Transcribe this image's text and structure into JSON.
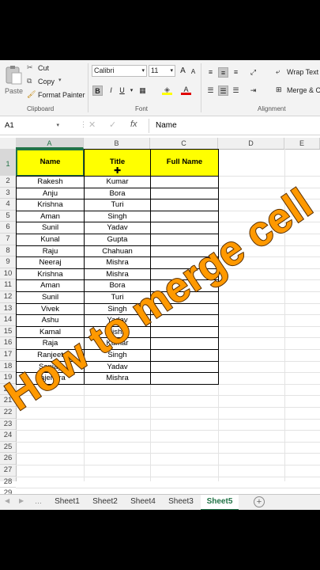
{
  "ribbon": {
    "clipboard": {
      "paste_label": "Paste",
      "cut_label": "Cut",
      "copy_label": "Copy",
      "format_painter_label": "Format Painter",
      "group_label": "Clipboard"
    },
    "font": {
      "font_name": "Calibri",
      "font_size": "11",
      "bold": "B",
      "italic": "I",
      "underline": "U",
      "grow": "A",
      "shrink": "A",
      "group_label": "Font"
    },
    "alignment": {
      "wrap_text_label": "Wrap Text",
      "merge_label": "Merge & C",
      "group_label": "Alignment"
    }
  },
  "formula_bar": {
    "name_box": "A1",
    "fx": "fx",
    "content": "Name"
  },
  "columns": [
    "A",
    "B",
    "C",
    "D",
    "E"
  ],
  "rows": [
    "1",
    "2",
    "3",
    "4",
    "5",
    "6",
    "7",
    "8",
    "9",
    "10",
    "11",
    "12",
    "13",
    "14",
    "15",
    "16",
    "17",
    "18",
    "19",
    "20",
    "21",
    "22",
    "23",
    "24",
    "25",
    "26",
    "27",
    "28",
    "29"
  ],
  "table": {
    "headers": [
      "Name",
      "Title",
      "Full Name"
    ],
    "rows": [
      [
        "Rakesh",
        "Kumar"
      ],
      [
        "Anju",
        "Bora"
      ],
      [
        "Krishna",
        "Turi"
      ],
      [
        "Aman",
        "Singh"
      ],
      [
        "Sunil",
        "Yadav"
      ],
      [
        "Kunal",
        "Gupta"
      ],
      [
        "Raju",
        "Chahuan"
      ],
      [
        "Neeraj",
        "Mishra"
      ],
      [
        "Krishna",
        "Mishra"
      ],
      [
        "Aman",
        "Bora"
      ],
      [
        "Sunil",
        "Turi"
      ],
      [
        "Vivek",
        "Singh"
      ],
      [
        "Ashu",
        "Yadav"
      ],
      [
        "Kamal",
        "Mishra"
      ],
      [
        "Raja",
        "Kumar"
      ],
      [
        "Ranjeet",
        "Singh"
      ],
      [
        "Sanjay",
        "Yadav"
      ],
      [
        "Rajendra",
        "Mishra"
      ]
    ]
  },
  "sheet_tabs": [
    "Sheet1",
    "Sheet2",
    "Sheet4",
    "Sheet3",
    "Sheet5"
  ],
  "active_sheet": "Sheet5",
  "overlay_text": "How to merge cell",
  "colors": {
    "accent": "#217346",
    "header_fill": "#ffff00",
    "overlay_fill": "#ff9900"
  }
}
